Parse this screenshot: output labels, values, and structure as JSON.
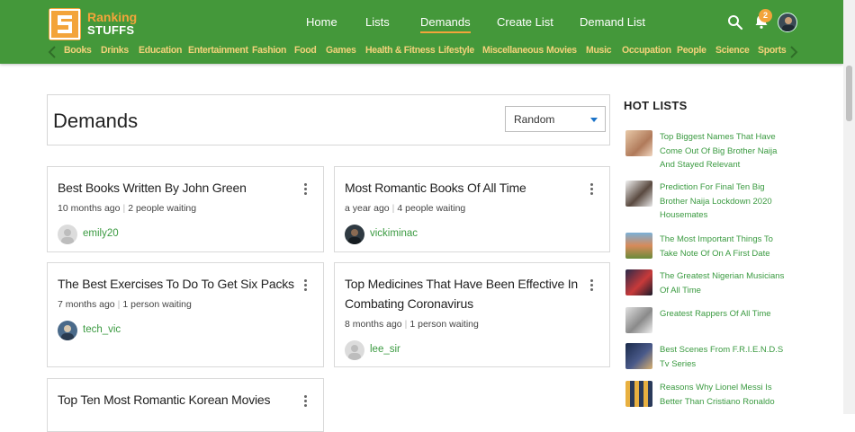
{
  "brand": {
    "line1": "Ranking",
    "line2": "STUFFS"
  },
  "nav": [
    {
      "label": "Home",
      "active": false
    },
    {
      "label": "Lists",
      "active": false
    },
    {
      "label": "Demands",
      "active": true
    },
    {
      "label": "Create List",
      "active": false
    },
    {
      "label": "Demand List",
      "active": false
    }
  ],
  "notifications": {
    "count": "2"
  },
  "categories": [
    "Books",
    "Drinks",
    "Education",
    "Entertainment",
    "Fashion",
    "Food",
    "Games",
    "Health & Fitness",
    "Lifestyle",
    "Miscellaneous",
    "Movies",
    "Music",
    "Occupation",
    "People",
    "Science",
    "Sports"
  ],
  "page": {
    "title": "Demands",
    "sort_value": "Random"
  },
  "demands": [
    {
      "title": "Best Books Written By John Green",
      "time": "10 months ago",
      "waiting": "2 people waiting",
      "user": "emily20"
    },
    {
      "title": "Most Romantic Books Of All Time",
      "time": "a year ago",
      "waiting": "4 people waiting",
      "user": "vickiminac"
    },
    {
      "title": "The Best Exercises To Do To Get Six Packs",
      "time": "7 months ago",
      "waiting": "1 person waiting",
      "user": "tech_vic"
    },
    {
      "title": "Top Medicines That Have Been Effective In Combating Coronavirus",
      "time": "8 months ago",
      "waiting": "1 person waiting",
      "user": "lee_sir"
    },
    {
      "title": "Top Ten Most Romantic Korean Movies",
      "time": "",
      "waiting": "",
      "user": ""
    }
  ],
  "hot_lists": {
    "heading": "HOT LISTS",
    "items": [
      "Top Biggest Names That Have Come Out Of Big Brother Naija And Stayed Relevant",
      "Prediction For Final Ten Big Brother Naija Lockdown 2020 Housemates",
      "The Most Important Things To Take Note Of On A First Date",
      "The Greatest Nigerian Musicians Of All Time",
      "Greatest Rappers Of All Time",
      "Best Scenes From F.R.I.E.N.D.S Tv Series",
      "Reasons Why Lionel Messi Is Better Than Cristiano Ronaldo"
    ]
  },
  "colors": {
    "brand_green": "#44983a",
    "accent_orange": "#f3a43a",
    "link_green": "#3a9a40"
  }
}
